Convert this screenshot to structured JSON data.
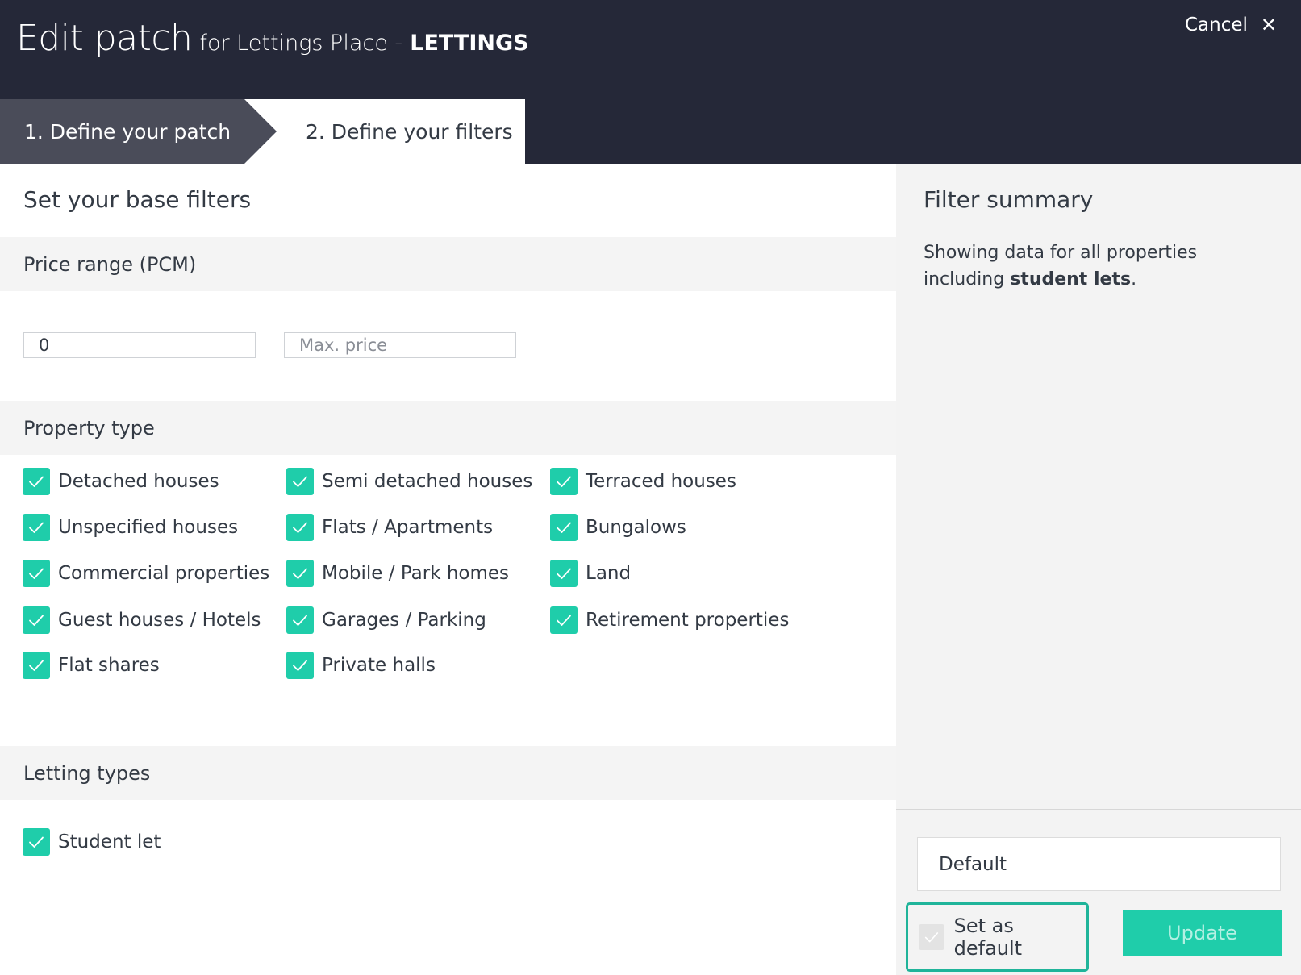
{
  "header": {
    "title_main": "Edit patch",
    "title_sub": "for Lettings Place -",
    "title_strong": "LETTINGS",
    "cancel_label": "Cancel",
    "close_icon": "close-icon"
  },
  "tabs": [
    {
      "label": "1. Define your patch",
      "active": false
    },
    {
      "label": "2. Define your filters",
      "active": true
    }
  ],
  "filters": {
    "base_title": "Set your base filters",
    "price": {
      "heading": "Price range (PCM)",
      "min_value": "0",
      "max_placeholder": "Max. price"
    },
    "property_type": {
      "heading": "Property type",
      "items": [
        {
          "label": "Detached houses",
          "checked": true
        },
        {
          "label": "Semi detached houses",
          "checked": true
        },
        {
          "label": "Terraced houses",
          "checked": true
        },
        {
          "label": "Unspecified houses",
          "checked": true
        },
        {
          "label": "Flats / Apartments",
          "checked": true
        },
        {
          "label": "Bungalows",
          "checked": true
        },
        {
          "label": "Commercial properties",
          "checked": true
        },
        {
          "label": "Mobile / Park homes",
          "checked": true
        },
        {
          "label": "Land",
          "checked": true
        },
        {
          "label": "Guest houses / Hotels",
          "checked": true
        },
        {
          "label": "Garages / Parking",
          "checked": true
        },
        {
          "label": "Retirement properties",
          "checked": true
        },
        {
          "label": "Flat shares",
          "checked": true
        },
        {
          "label": "Private halls",
          "checked": true
        }
      ]
    },
    "letting_types": {
      "heading": "Letting types",
      "items": [
        {
          "label": "Student let",
          "checked": true
        }
      ]
    }
  },
  "summary": {
    "title": "Filter summary",
    "text_prefix": "Showing data for all properties including",
    "text_strong": "student lets",
    "text_suffix": ".",
    "name_value": "Default",
    "set_default_label": "Set as default",
    "set_default_checked": false,
    "update_label": "Update"
  },
  "colors": {
    "header_bg": "#252838",
    "accent": "#1fcdaa",
    "focus_border": "#20b49a"
  }
}
